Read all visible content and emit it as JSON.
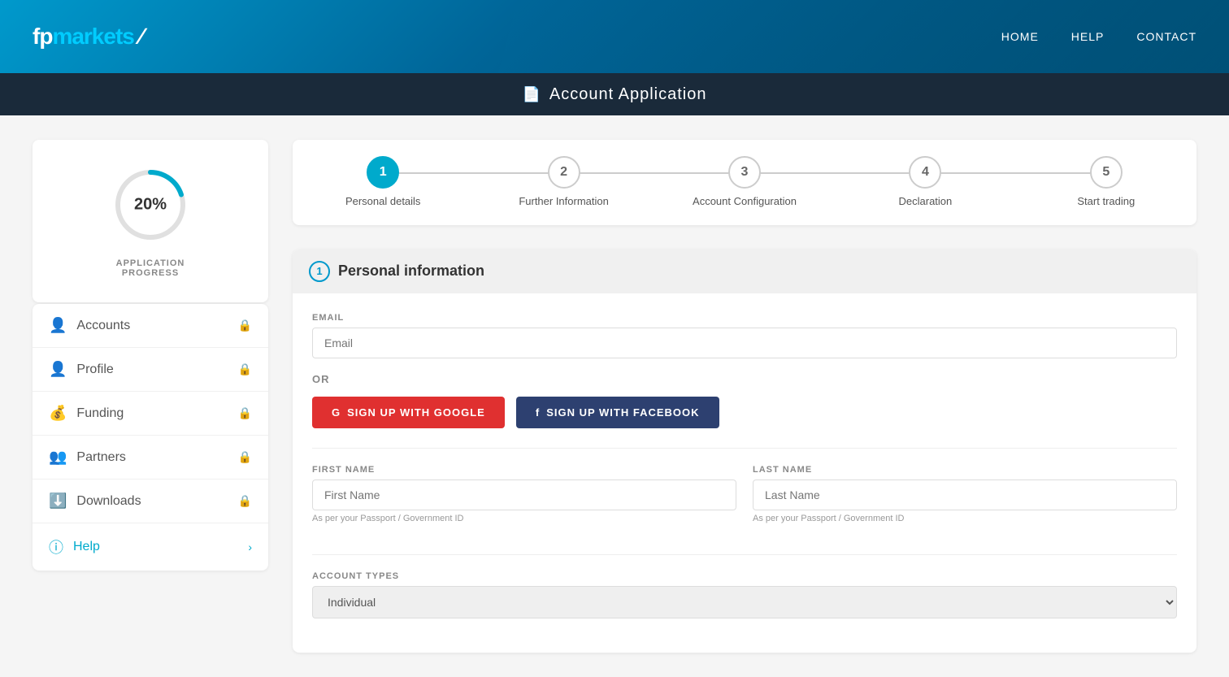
{
  "header": {
    "logo_text": "fpmarkets",
    "nav": [
      {
        "label": "HOME",
        "id": "home"
      },
      {
        "label": "HELP",
        "id": "help"
      },
      {
        "label": "CONTACT",
        "id": "contact"
      }
    ]
  },
  "page_title": "Account Application",
  "stepper": {
    "steps": [
      {
        "number": "1",
        "label": "Personal details",
        "state": "active"
      },
      {
        "number": "2",
        "label": "Further Information",
        "state": "inactive"
      },
      {
        "number": "3",
        "label": "Account Configuration",
        "state": "inactive"
      },
      {
        "number": "4",
        "label": "Declaration",
        "state": "inactive"
      },
      {
        "number": "5",
        "label": "Start trading",
        "state": "inactive"
      }
    ]
  },
  "sidebar": {
    "progress_percent": "20%",
    "progress_label": "APPLICATION\nPROGRESS",
    "nav_items": [
      {
        "id": "accounts",
        "label": "Accounts",
        "icon": "person",
        "locked": true
      },
      {
        "id": "profile",
        "label": "Profile",
        "icon": "person-edit",
        "locked": true
      },
      {
        "id": "funding",
        "label": "Funding",
        "icon": "coins",
        "locked": true
      },
      {
        "id": "partners",
        "label": "Partners",
        "icon": "people",
        "locked": true
      },
      {
        "id": "downloads",
        "label": "Downloads",
        "icon": "download",
        "locked": true
      },
      {
        "id": "help",
        "label": "Help",
        "icon": "help-circle",
        "locked": false,
        "chevron": true
      }
    ]
  },
  "form": {
    "section_number": "1",
    "section_title": "Personal information",
    "email_label": "EMAIL",
    "email_placeholder": "Email",
    "or_text": "OR",
    "google_btn": "SIGN UP WITH GOOGLE",
    "facebook_btn": "SIGN UP WITH FACEBOOK",
    "first_name_label": "FIRST NAME",
    "first_name_placeholder": "First Name",
    "first_name_hint": "As per your Passport / Government ID",
    "last_name_label": "LAST NAME",
    "last_name_placeholder": "Last Name",
    "last_name_hint": "As per your Passport / Government ID",
    "account_types_label": "ACCOUNT TYPES"
  },
  "colors": {
    "accent": "#00aacc",
    "google_red": "#e03030",
    "facebook_blue": "#2d4070",
    "header_bg": "#006699",
    "title_bar_bg": "#1a2a3a"
  }
}
